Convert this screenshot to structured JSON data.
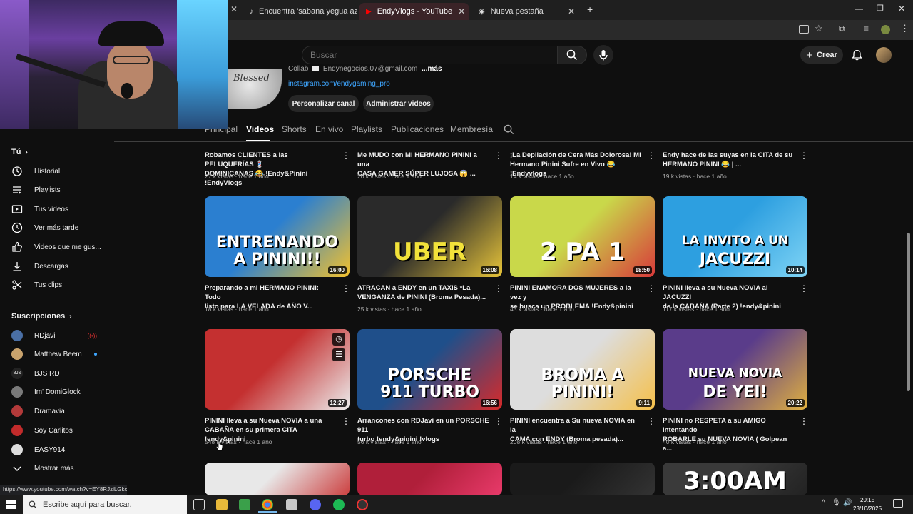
{
  "browser": {
    "tabs": [
      {
        "title": "Encuentra 'sabana yegua azua",
        "active": false
      },
      {
        "title": "EndyVlogs - YouTube",
        "active": true
      },
      {
        "title": "Nueva pestaña",
        "active": false
      }
    ],
    "new_tab_icon": "plus-icon",
    "window_controls": [
      "minimize-icon",
      "restore-icon",
      "close-icon"
    ]
  },
  "header": {
    "search_placeholder": "Buscar",
    "create_label": "Crear"
  },
  "channel": {
    "collab_label": "Collab",
    "email": "Endynegocios.07@gmail.com",
    "more": "...más",
    "instagram": "instagram.com/endygaming_pro",
    "customize_label": "Personalizar canal",
    "manage_label": "Administrar videos",
    "tabs": [
      "Principal",
      "Videos",
      "Shorts",
      "En vivo",
      "Playlists",
      "Publicaciones",
      "Membresía"
    ],
    "active_tab": "Videos"
  },
  "sidebar": {
    "you_label": "Tú",
    "items": [
      "Historial",
      "Playlists",
      "Tus videos",
      "Ver más tarde",
      "Videos que me gus...",
      "Descargas",
      "Tus clips"
    ],
    "subs_label": "Suscripciones",
    "subscriptions": [
      {
        "name": "RDjavi",
        "live": true,
        "color": "#4a6fa5"
      },
      {
        "name": "Matthew Beem",
        "dot": true,
        "color": "#c9a36d"
      },
      {
        "name": "BJS RD",
        "color": "#222222"
      },
      {
        "name": "Im' DomiGlock",
        "color": "#7a7a7a"
      },
      {
        "name": "Dramavia",
        "color": "#b33a3a"
      },
      {
        "name": "Soy Carlitos",
        "color": "#c22b2b"
      },
      {
        "name": "EASY914",
        "color": "#dddddd"
      }
    ],
    "show_more": "Mostrar más"
  },
  "videos": [
    {
      "title1": "Robamos CLIENTES a las PELUQUERÍAS 💈",
      "title2": "DOMINICANAS 😂 !Endy&Pinini !EndyVlogs",
      "views": "27 k vistas",
      "age": "hace 1 año"
    },
    {
      "title1": "Me MUDO con MI HERMANO PININI a una",
      "title2": "CASA GAMER SÚPER LUJOSA 😱 ...",
      "views": "20 k vistas",
      "age": "hace 1 año"
    },
    {
      "title1": "¡La Depilación de Cera Más Dolorosa! Mi",
      "title2": "Hermano Pinini Sufre en Vivo 😂 !Endyvlogs",
      "views": "14 k vistas",
      "age": "hace 1 año"
    },
    {
      "title1": "Endy hace de las suyas en la CITA de su",
      "title2": "HERMANO PININI 😂 | ...",
      "views": "19 k vistas",
      "age": "hace 1 año"
    },
    {
      "title1": "Preparando a mi HERMANO PININI: Todo",
      "title2": "listo para LA VELADA de AÑO V...",
      "views": "18 k vistas",
      "age": "hace 1 año",
      "duration": "16:00",
      "thumb_text": [
        "ENTRENANDO",
        "A PININI!!"
      ]
    },
    {
      "title1": "ATRACAN a ENDY en un TAXIS *La",
      "title2": "VENGANZA de PININI (Broma Pesada)...",
      "views": "25 k vistas",
      "age": "hace 1 año",
      "duration": "16:08",
      "thumb_text": [
        "UBER"
      ]
    },
    {
      "title1": "PININI ENAMORA DOS MUJERES a la vez y",
      "title2": "se busca un PROBLEMA !Endy&pinini",
      "views": "43 k vistas",
      "age": "hace 1 año",
      "duration": "18:50",
      "thumb_text": [
        "2 PA 1"
      ]
    },
    {
      "title1": "PININI lleva a su Nueva NOVIA al JACUZZI",
      "title2": "de la CABAÑA (Parte 2) !endy&pinini",
      "views": "117 k vistas",
      "age": "hace 1 año",
      "duration": "10:14",
      "thumb_text": [
        "LA INVITO A UN",
        "JACUZZI"
      ]
    },
    {
      "title1": "PININI lleva a su Nueva NOVIA a una",
      "title2": "CABAÑA en su primera CITA !endy&pinini",
      "views": "548 k vistas",
      "age": "hace 1 año",
      "duration": "12:27",
      "thumb_text": []
    },
    {
      "title1": "Arrancones con RDJavi en un PORSCHE 911",
      "title2": "turbo !endy&pinini !vlogs",
      "views": "56 k vistas",
      "age": "hace 1 año",
      "duration": "16:56",
      "thumb_text": [
        "PORSCHE",
        "911 TURBO"
      ]
    },
    {
      "title1": "PININI encuentra a Su nueva NOVIA en la",
      "title2": "CAMA con ENDY (Broma pesada)...",
      "views": "208 k vistas",
      "age": "hace 1 año",
      "duration": "9:11",
      "thumb_text": [
        "BROMA A",
        "PININI!"
      ]
    },
    {
      "title1": "PININI no RESPETA a su AMIGO intentando",
      "title2": "ROBARLE su NUEVA NOVIA ( Golpean a...",
      "views": "40 k vistas",
      "age": "hace 1 año",
      "duration": "20:22",
      "thumb_text": [
        "NUEVA NOVIA",
        "DE YEI!"
      ]
    },
    {
      "thumb_text": []
    },
    {
      "thumb_text": []
    },
    {
      "thumb_text": []
    },
    {
      "thumb_text": [
        "3:00AM"
      ]
    }
  ],
  "status_url": "https://www.youtube.com/watch?v=EY8RJziLGkc",
  "taskbar": {
    "search_placeholder": "Escribe aquí para buscar.",
    "time": "20:15",
    "date": "23/10/2025"
  }
}
